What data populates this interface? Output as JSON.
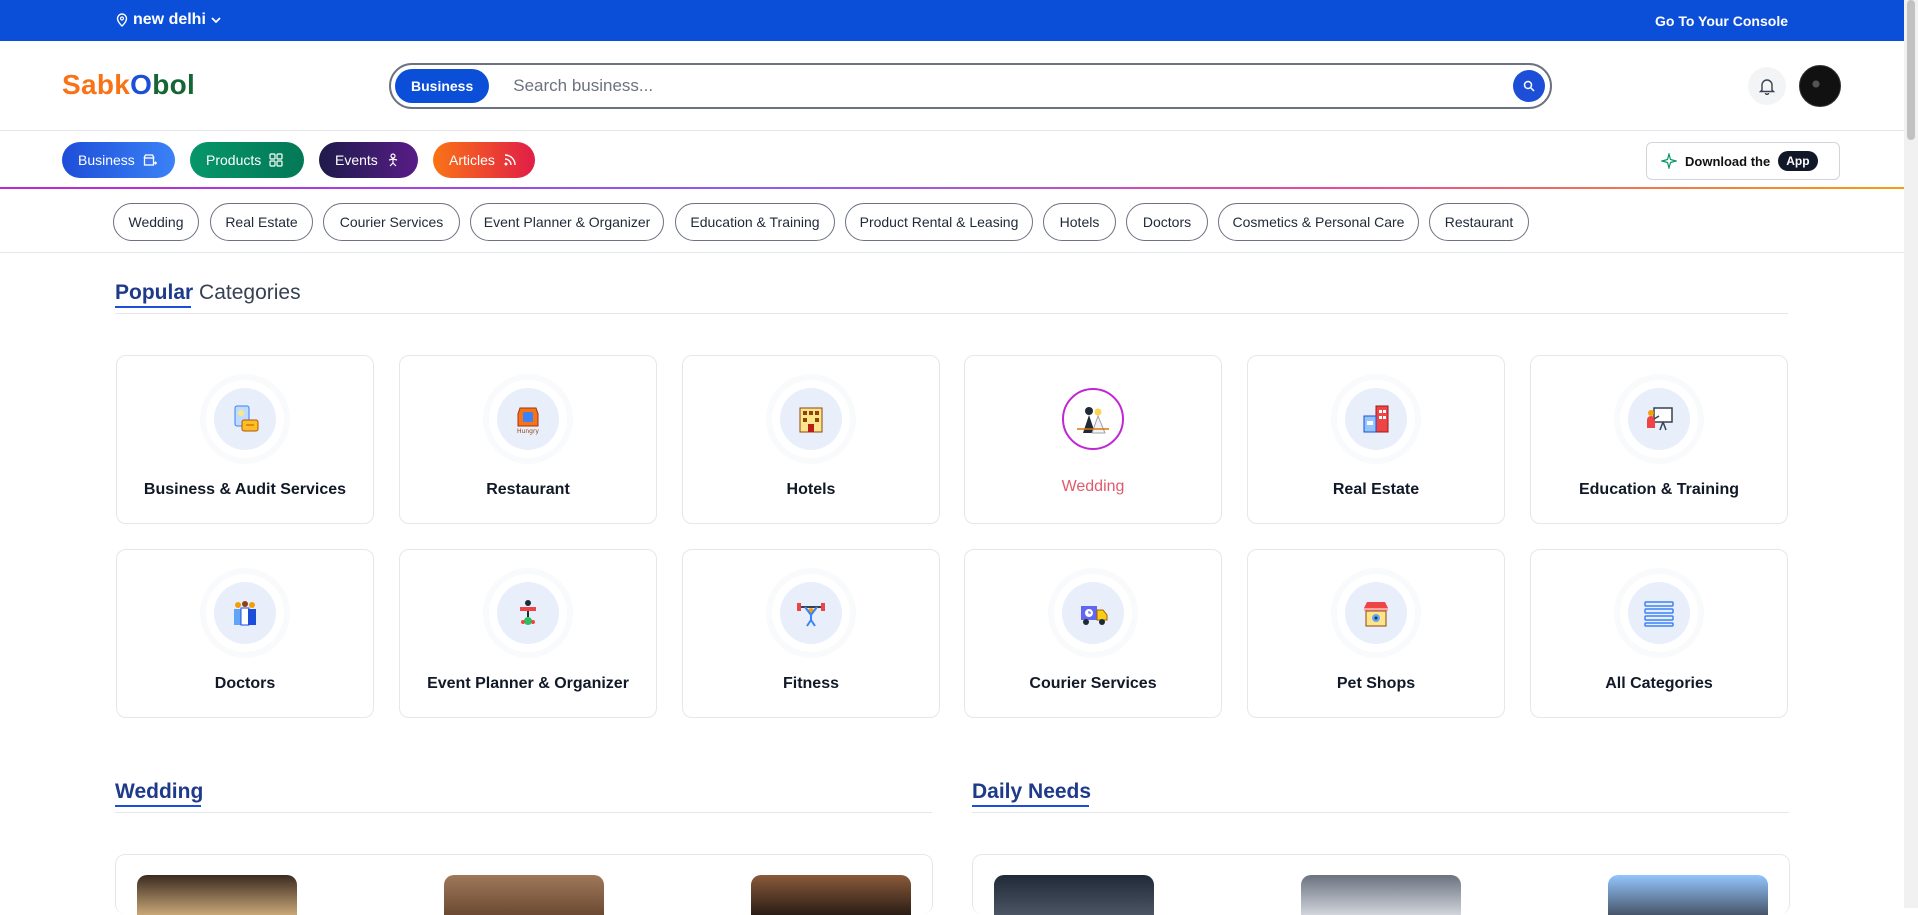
{
  "topbar": {
    "location": "new delhi",
    "console_link": "Go To Your Console"
  },
  "header": {
    "logo": {
      "part1": "Sabk",
      "part2": "O",
      "part3": "bol"
    },
    "search": {
      "scope": "Business",
      "placeholder": "Search business..."
    }
  },
  "nav": {
    "items": [
      {
        "label": "Business",
        "icon": "store-icon"
      },
      {
        "label": "Products",
        "icon": "grid-icon"
      },
      {
        "label": "Events",
        "icon": "performer-icon"
      },
      {
        "label": "Articles",
        "icon": "rss-icon"
      }
    ],
    "download": {
      "label": "Download the",
      "badge": "App"
    }
  },
  "chips": [
    "Wedding",
    "Real Estate",
    "Courier Services",
    "Event Planner & Organizer",
    "Education & Training",
    "Product Rental & Leasing",
    "Hotels",
    "Doctors",
    "Cosmetics & Personal Care",
    "Restaurant"
  ],
  "popular": {
    "title_bold": "Popular",
    "title_rest": "Categories",
    "categories": [
      {
        "label": "Business & Audit Services",
        "icon": "audit-icon"
      },
      {
        "label": "Restaurant",
        "icon": "restaurant-icon"
      },
      {
        "label": "Hotels",
        "icon": "hotel-icon"
      },
      {
        "label": "Wedding",
        "icon": "wedding-icon",
        "active": true
      },
      {
        "label": "Real Estate",
        "icon": "building-icon"
      },
      {
        "label": "Education & Training",
        "icon": "teacher-icon"
      },
      {
        "label": "Doctors",
        "icon": "doctors-icon"
      },
      {
        "label": "Event Planner & Organizer",
        "icon": "event-icon"
      },
      {
        "label": "Fitness",
        "icon": "fitness-icon"
      },
      {
        "label": "Courier Services",
        "icon": "courier-truck-icon"
      },
      {
        "label": "Pet Shops",
        "icon": "pet-shop-icon"
      },
      {
        "label": "All Categories",
        "icon": "list-icon"
      }
    ]
  },
  "sections": {
    "wedding": "Wedding",
    "daily_needs": "Daily Needs"
  },
  "colors": {
    "primary": "#0b4fd9",
    "accent_wedding": "#e05a6d"
  }
}
